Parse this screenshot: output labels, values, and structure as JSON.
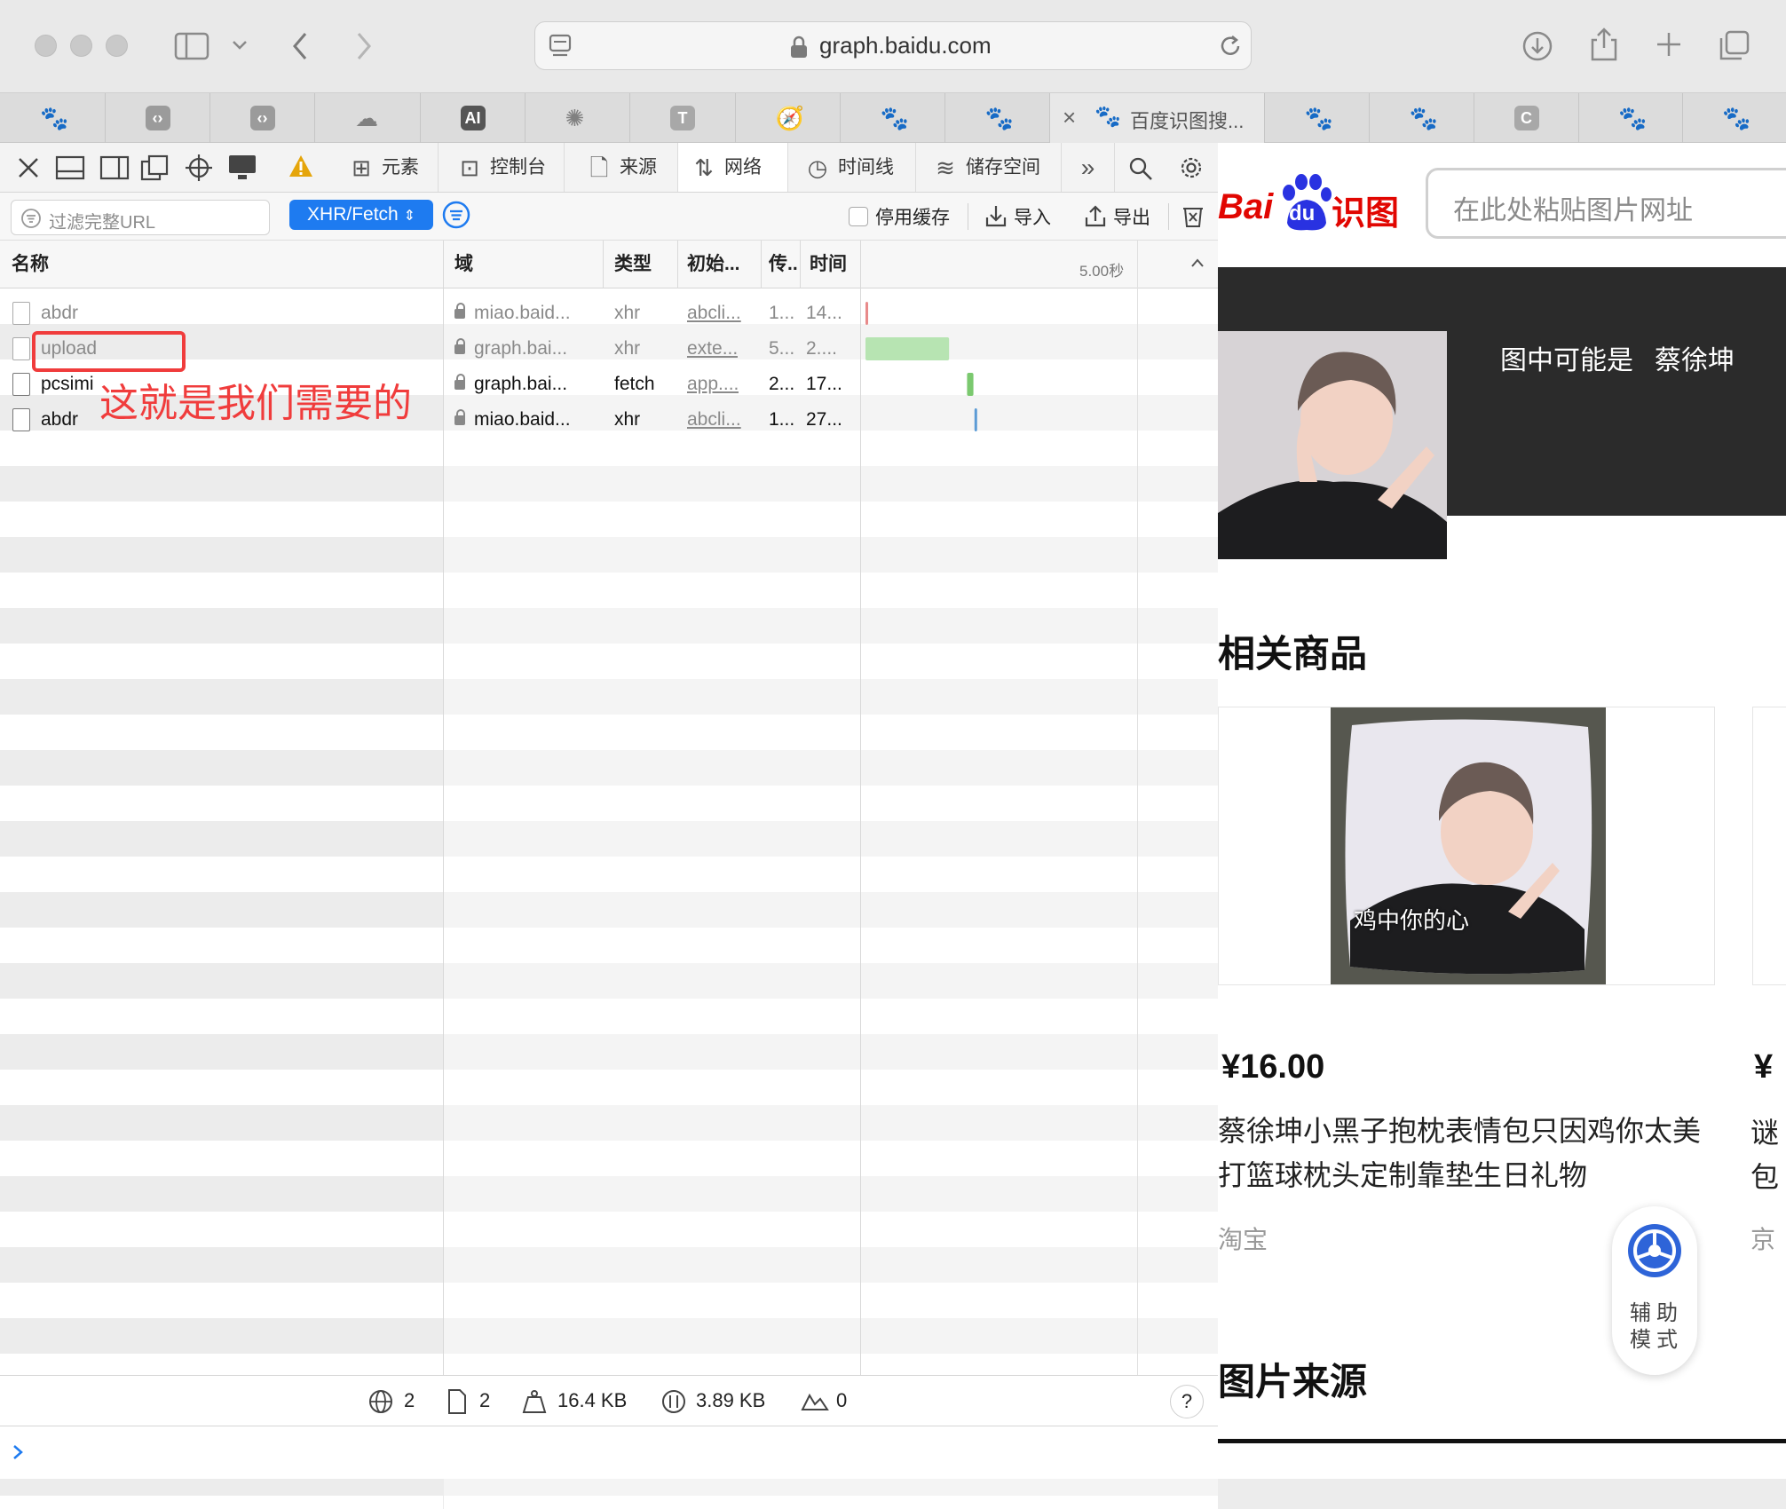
{
  "browser": {
    "url": "graph.baidu.com",
    "tabs": [
      {
        "kind": "paw"
      },
      {
        "kind": "code"
      },
      {
        "kind": "code"
      },
      {
        "kind": "cloud"
      },
      {
        "kind": "text",
        "label": "AI"
      },
      {
        "kind": "openai"
      },
      {
        "kind": "text",
        "label": "T"
      },
      {
        "kind": "compass"
      },
      {
        "kind": "paw"
      },
      {
        "kind": "paw"
      },
      {
        "kind": "active",
        "label": "百度识图搜..."
      },
      {
        "kind": "paw"
      },
      {
        "kind": "paw"
      },
      {
        "kind": "text",
        "label": "C"
      },
      {
        "kind": "paw"
      },
      {
        "kind": "paw"
      }
    ]
  },
  "devtools": {
    "tabs": {
      "elements": "元素",
      "console": "控制台",
      "sources": "来源",
      "network": "网络",
      "timelines": "时间线",
      "storage": "储存空间"
    },
    "filter_placeholder": "过滤完整URL",
    "type_filter": "XHR/Fetch",
    "disable_cache": "停用缓存",
    "import": "导入",
    "export": "导出",
    "columns": {
      "name": "名称",
      "domain": "域",
      "type": "类型",
      "initiator": "初始...",
      "transfer": "传..",
      "time": "时间",
      "waterfall_scale": "5.00秒"
    },
    "rows": [
      {
        "name": "abdr",
        "domain": "miao.baid...",
        "type": "xhr",
        "initiator": "abcli...",
        "transfer": "1...",
        "time": "14...",
        "muted": true
      },
      {
        "name": "upload",
        "domain": "graph.bai...",
        "type": "xhr",
        "initiator": "exte...",
        "transfer": "5...",
        "time": "2....",
        "muted": true
      },
      {
        "name": "pcsimi",
        "domain": "graph.bai...",
        "type": "fetch",
        "initiator": "app....",
        "transfer": "2...",
        "time": "17...",
        "muted": false
      },
      {
        "name": "abdr",
        "domain": "miao.baid...",
        "type": "xhr",
        "initiator": "abcli...",
        "transfer": "1...",
        "time": "27...",
        "muted": false
      }
    ],
    "waterfall": [
      {
        "start_s": 0.0,
        "end_s": 0.05,
        "color": "#e88a8a"
      },
      {
        "start_s": 0.0,
        "end_s": 1.58,
        "color": "#b7e4b2"
      },
      {
        "start_s": 1.92,
        "end_s": 2.04,
        "color": "#7bc96f"
      },
      {
        "start_s": 2.06,
        "end_s": 2.1,
        "color": "#5b9bd5"
      }
    ],
    "waterfall_range_s": [
      0,
      5
    ],
    "status": {
      "resources": "2",
      "documents": "2",
      "size": "16.4 KB",
      "transferred": "3.89 KB",
      "errors": "0",
      "help": "?"
    }
  },
  "annotation": {
    "text": "这就是我们需要的",
    "color": "#f03c3c"
  },
  "page": {
    "logo_bai": "Bai",
    "logo_du": "du",
    "logo_suffix": "识图",
    "search_placeholder": "在此处粘贴图片网址",
    "guess_label": "图中可能是",
    "guess_name": "蔡徐坤",
    "related_title": "相关商品",
    "pillow_caption": "鸡中你的心",
    "price": "¥16.00",
    "product_title": "蔡徐坤小黑子抱枕表情包只因鸡你太美打篮球枕头定制靠垫生日礼物",
    "shop": "淘宝",
    "next_price": "¥",
    "next_title_1": "谜",
    "next_title_2": "包",
    "next_shop": "京",
    "assist_1": "辅助",
    "assist_2": "模式",
    "source_title": "图片来源"
  }
}
